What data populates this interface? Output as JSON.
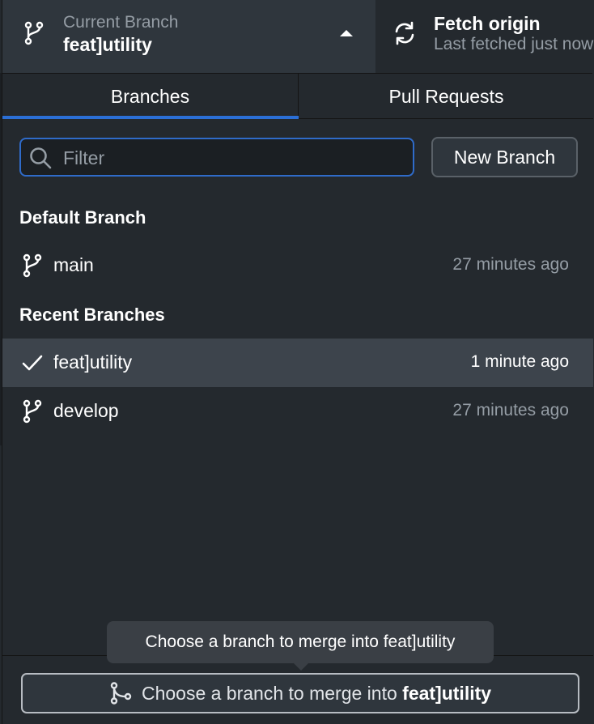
{
  "toolbar": {
    "current_branch": {
      "caption": "Current Branch",
      "name": "feat]utility"
    },
    "fetch": {
      "title": "Fetch origin",
      "subtitle": "Last fetched just now"
    }
  },
  "tabs": [
    {
      "label": "Branches",
      "active": true
    },
    {
      "label": "Pull Requests",
      "active": false
    }
  ],
  "filter": {
    "placeholder": "Filter",
    "value": ""
  },
  "new_branch_label": "New Branch",
  "sections": {
    "default_header": "Default Branch",
    "recent_header": "Recent Branches"
  },
  "default_branches": [
    {
      "name": "main",
      "time": "27 minutes ago",
      "icon": "git-branch-icon"
    }
  ],
  "recent_branches": [
    {
      "name": "feat]utility",
      "time": "1 minute ago",
      "icon": "check-icon",
      "selected": true
    },
    {
      "name": "develop",
      "time": "27 minutes ago",
      "icon": "git-branch-icon",
      "selected": false
    }
  ],
  "merge": {
    "prefix": "Choose a branch to merge into",
    "target": "feat]utility",
    "tooltip": "Choose a branch to merge into feat]utility"
  },
  "colors": {
    "background": "#24292e",
    "accent": "#2b6fd6",
    "selected_row": "#3d444c",
    "muted_text": "#959da5"
  }
}
